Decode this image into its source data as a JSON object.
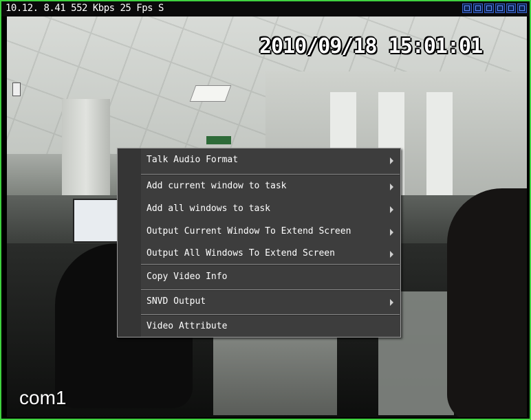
{
  "status_bar": {
    "info": "10.12. 8.41 552 Kbps 25 Fps S",
    "icons": [
      "layout-single-icon",
      "layout-quad-icon",
      "snapshot-icon",
      "record-icon",
      "audio-icon",
      "close-icon"
    ]
  },
  "video": {
    "timestamp": "2010/09/18 15:01:01",
    "channel": "com1"
  },
  "context_menu": {
    "items": [
      {
        "label": "Talk Audio Format",
        "submenu": true
      },
      {
        "label": "Add current window to task",
        "submenu": true
      },
      {
        "label": "Add all windows to task",
        "submenu": true
      },
      {
        "label": "Output Current Window To Extend Screen",
        "submenu": true
      },
      {
        "label": "Output All Windows To Extend Screen",
        "submenu": true
      },
      {
        "label": "Copy Video Info",
        "submenu": false
      },
      {
        "label": "SNVD Output",
        "submenu": true
      },
      {
        "label": "Video Attribute",
        "submenu": false
      }
    ]
  },
  "colors": {
    "border": "#3fd23f",
    "menu_bg": "#3d3d3d",
    "menu_text": "#ffffff"
  }
}
